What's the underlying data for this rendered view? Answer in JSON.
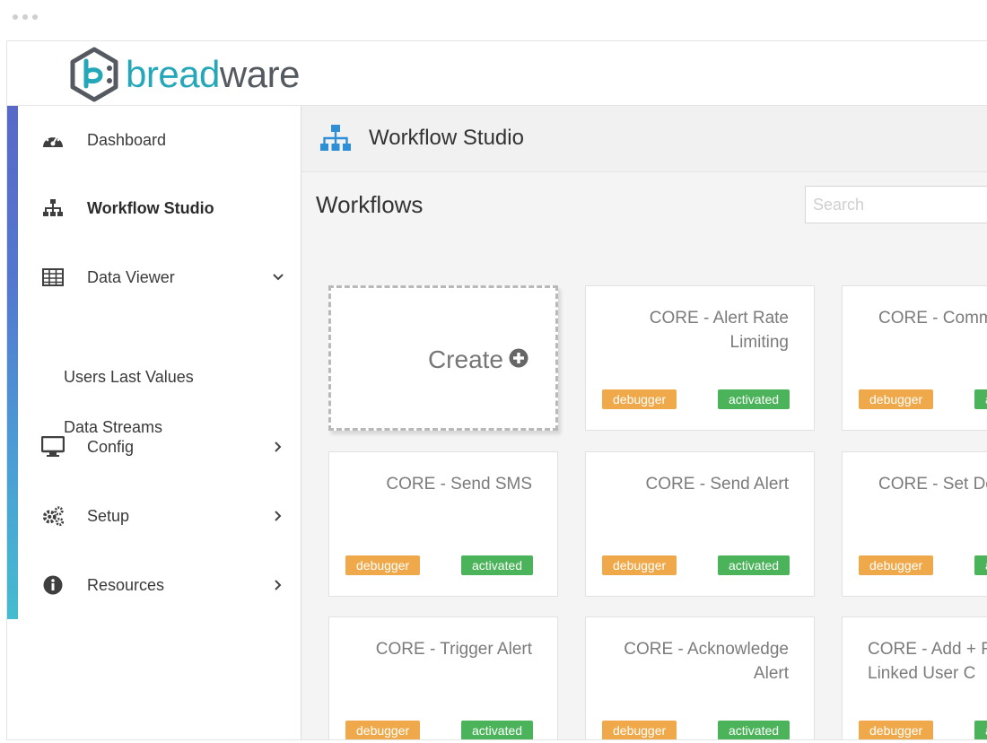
{
  "brand": {
    "part1": "bread",
    "part2": "ware",
    "color_primary": "#24a7b8",
    "color_secondary": "#555a60"
  },
  "sidebar": {
    "items": [
      {
        "label": "Dashboard",
        "icon": "gauge-icon"
      },
      {
        "label": "Workflow Studio",
        "icon": "sitemap-icon",
        "active": true
      },
      {
        "label": "Data Viewer",
        "icon": "table-icon",
        "expanded": true,
        "children": [
          {
            "label": "Users Last Values"
          },
          {
            "label": "Data Streams"
          }
        ]
      },
      {
        "label": "Config",
        "icon": "monitor-icon"
      },
      {
        "label": "Setup",
        "icon": "gears-icon"
      },
      {
        "label": "Resources",
        "icon": "info-icon"
      }
    ]
  },
  "page": {
    "title": "Workflow Studio"
  },
  "workflows": {
    "heading": "Workflows",
    "search_placeholder": "Search",
    "create_label": "Create",
    "badge_debugger": "debugger",
    "badge_activated": "activated",
    "cards": [
      {
        "title": "CORE - Alert Rate\nLimiting"
      },
      {
        "title": "CORE - Comm"
      },
      {
        "title": "CORE - Send SMS"
      },
      {
        "title": "CORE - Send Alert"
      },
      {
        "title": "CORE - Set De"
      },
      {
        "title": "CORE - Trigger Alert"
      },
      {
        "title": "CORE - Acknowledge\nAlert"
      },
      {
        "title": "CORE - Add + R\nLinked User C"
      }
    ]
  },
  "colors": {
    "debugger": "#f0a94a",
    "activated": "#4bb45a",
    "icon_blue": "#2f8fd6"
  }
}
